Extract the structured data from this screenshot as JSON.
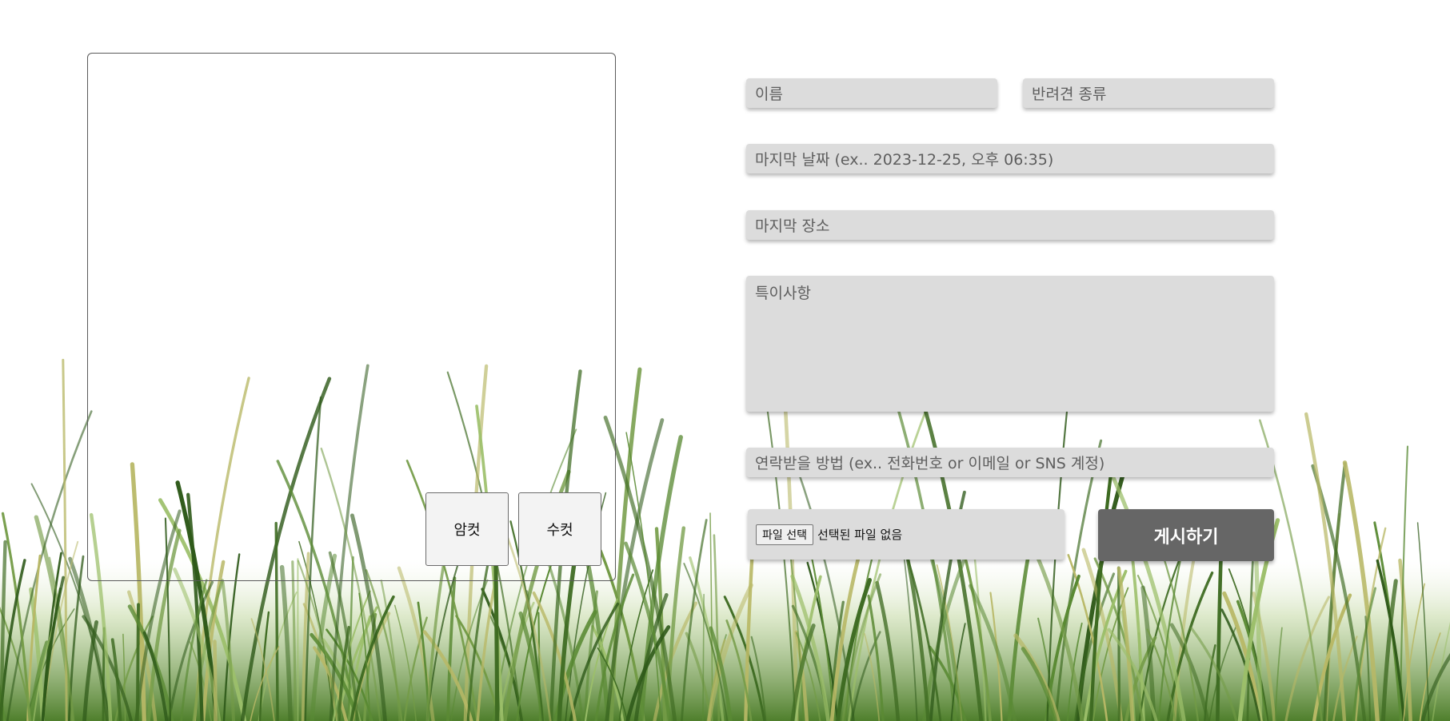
{
  "preview": {
    "female_label": "암컷",
    "male_label": "수컷"
  },
  "form": {
    "name_placeholder": "이름",
    "breed_placeholder": "반려견 종류",
    "last_date_placeholder": "마지막 날짜  (ex.. 2023-12-25, 오후 06:35)",
    "last_place_placeholder": "마지막 장소",
    "notes_placeholder": "특이사항",
    "contact_placeholder": "연락받을 방법  (ex.. 전화번호 or 이메일 or SNS 계정)",
    "file_button_label": "파일 선택",
    "file_status": "선택된 파일 없음",
    "submit_label": "게시하기"
  },
  "colors": {
    "field_bg": "#dcdcdc",
    "placeholder_text": "#5e5e5e",
    "submit_bg": "#666666",
    "submit_text": "#ffffff",
    "grass_dark": "#3e6b22",
    "grass_light": "#9cbf6a"
  }
}
